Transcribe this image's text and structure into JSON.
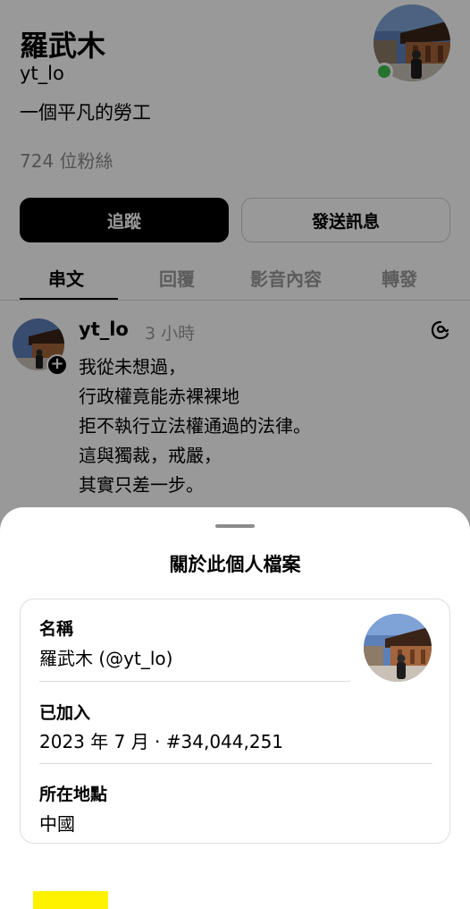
{
  "profile": {
    "name": "羅武木",
    "handle": "yt_lo",
    "bio": "一個平凡的勞工",
    "followers": "724 位粉絲",
    "follow_button": "追蹤",
    "message_button": "發送訊息",
    "tabs": [
      {
        "label": "串文"
      },
      {
        "label": "回覆"
      },
      {
        "label": "影音內容"
      },
      {
        "label": "轉發"
      }
    ]
  },
  "post": {
    "author": "yt_lo",
    "time": "3 小時",
    "lines": [
      "我從未想過，",
      "行政權竟能赤裸裸地",
      "拒不執行立法權通過的法律。",
      "這與獨裁，戒嚴，",
      "其實只差一步。"
    ]
  },
  "about_sheet": {
    "title": "關於此個人檔案",
    "name_label": "名稱",
    "name_value": "羅武木 (@yt_lo)",
    "joined_label": "已加入",
    "joined_value": "2023 年 7 月 · #34,044,251",
    "location_label": "所在地點",
    "location_value": "中國"
  },
  "colors": {
    "online_dot": "#3ec04b",
    "highlight": "#fff200",
    "follow_button_bg": "#000000"
  }
}
